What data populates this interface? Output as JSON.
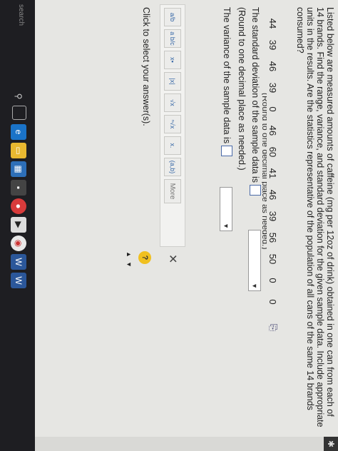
{
  "question": {
    "text": "Listed below are measured amounts of caffeine (mg per 12oz of drink) obtained in one can from each of 14 brands. Find the range, variance, and standard deviation for the given sample data. Include appropriate units in the results. Are the statistics representative of the population of all cans of the same 14 brands consumed?",
    "values": [
      "44",
      "39",
      "46",
      "39",
      "0",
      "46",
      "60",
      "41",
      "46",
      "39",
      "56",
      "50",
      "0",
      "0"
    ],
    "partial_note": "(Round to one decimal place as needed.)"
  },
  "answers": {
    "std_dev_label": "The standard deviation of the sample data is",
    "std_dev_note": "(Round to one decimal place as needed.)",
    "variance_label": "The variance of the sample data is"
  },
  "toolbar": {
    "buttons": [
      "a/b",
      "a b/c",
      "x▪",
      "|x|",
      "√x",
      "ⁿ√x",
      "x.",
      "(a,b)"
    ],
    "more_label": "More"
  },
  "footer": {
    "click_text": "Click to select your answer(s).",
    "help_label": "?"
  },
  "taskbar": {
    "search_label": "search"
  }
}
